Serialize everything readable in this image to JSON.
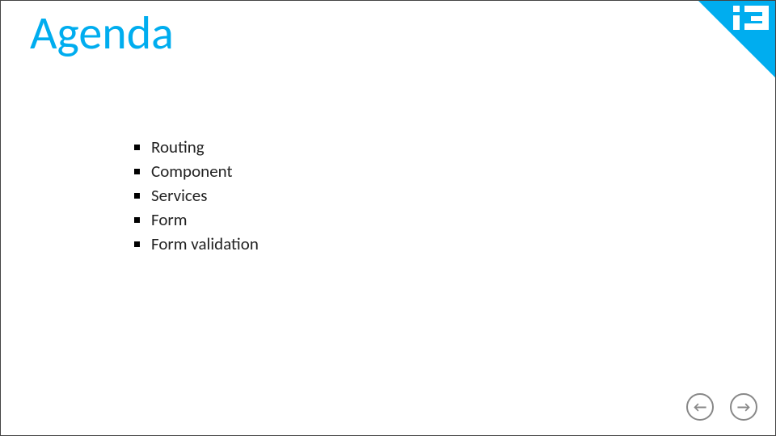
{
  "title": "Agenda",
  "items": [
    "Routing",
    "Component",
    "Services",
    "Form",
    "Form validation"
  ],
  "logo_name": "ig-logo",
  "nav": {
    "prev_glyph": "←",
    "next_glyph": "→"
  },
  "colors": {
    "accent": "#00ADEF"
  }
}
